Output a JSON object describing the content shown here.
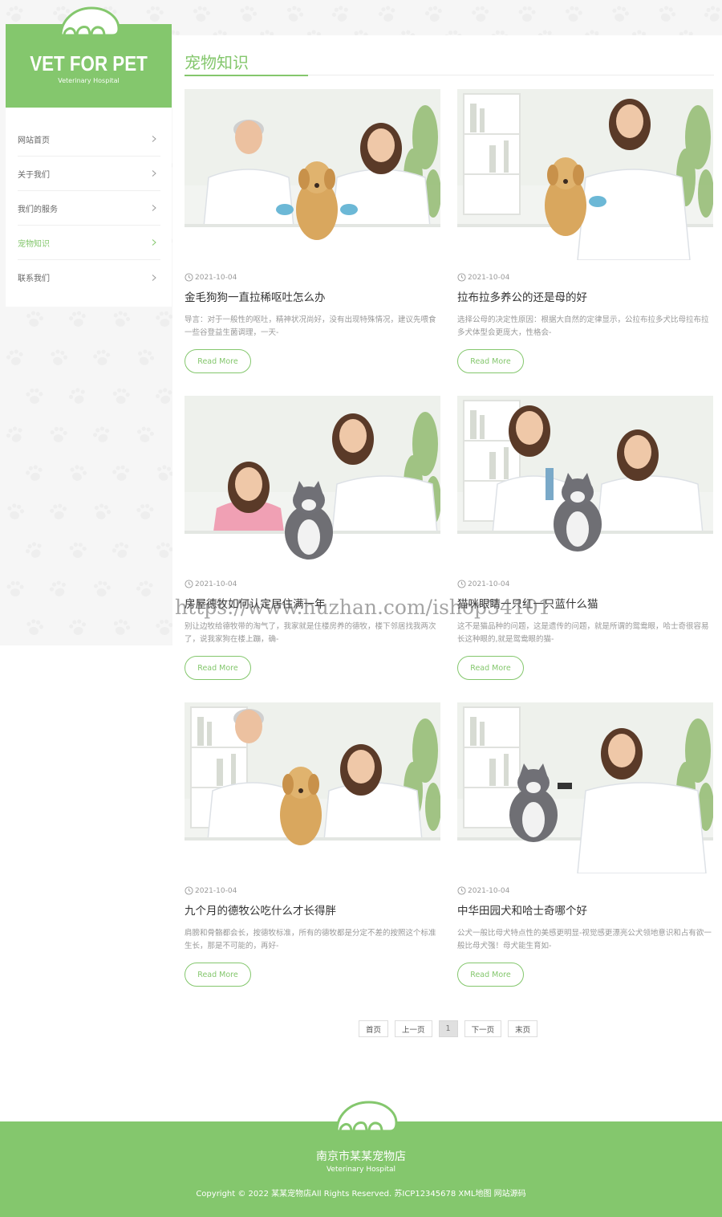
{
  "brand": {
    "name": "VET FOR PET",
    "subtitle": "Veterinary Hospital"
  },
  "nav": {
    "items": [
      {
        "label": "网站首页"
      },
      {
        "label": "关于我们"
      },
      {
        "label": "我们的服务"
      },
      {
        "label": "宠物知识"
      },
      {
        "label": "联系我们"
      }
    ],
    "active": "宠物知识"
  },
  "page": {
    "title": "宠物知识"
  },
  "articles": [
    {
      "date": "2021-10-04",
      "title": "金毛狗狗一直拉稀呕吐怎么办",
      "desc": "导言：对于一般性的呕吐，精神状况尚好，没有出现特殊情况，建议先喂食一些谷登益生菌调理，一天-",
      "image": "vet-man-woman-with-golden-puppy",
      "button": "Read More"
    },
    {
      "date": "2021-10-04",
      "title": "拉布拉多养公的还是母的好",
      "desc": "选择公母的决定性原因：根据大自然的定律显示，公拉布拉多犬比母拉布拉多犬体型会更庞大，性格会-",
      "image": "vet-woman-stethoscope-puppy",
      "button": "Read More"
    },
    {
      "date": "2021-10-04",
      "title": "房屋德牧如何认定居住满一年",
      "desc": "别让边牧给德牧带的淘气了，我家就是住楼房养的德牧，楼下邻居找我两次了，说我家狗在楼上蹦，确-",
      "image": "girl-vet-woman-with-cat",
      "button": "Read More"
    },
    {
      "date": "2021-10-04",
      "title": "猫咪眼睛一只红一只蓝什么猫",
      "desc": "这不是猫品种的问题，这是遗传的问题，就是所谓的鸳鸯眼，哈士奇很容易长这种眼的,就是鸳鸯眼的猫-",
      "image": "two-vets-grooming-cat",
      "button": "Read More"
    },
    {
      "date": "2021-10-04",
      "title": "九个月的德牧公吃什么才长得胖",
      "desc": "肩膀和骨骼都会长，按德牧标准，所有的德牧都是分定不差的按照这个标准生长，那是不可能的，再好-",
      "image": "vets-examining-golden-dog",
      "button": "Read More"
    },
    {
      "date": "2021-10-04",
      "title": "中华田园犬和哈士奇哪个好",
      "desc": "公犬一般比母犬特点性的美感更明显-视觉感更漂亮公犬领地意识和占有欲一般比母犬强！母犬能生育如-",
      "image": "vet-woman-otoscope-cat",
      "button": "Read More"
    }
  ],
  "watermark": "https://www.huzhan.com/ishop34101",
  "pagination": {
    "first": "首页",
    "prev": "上一页",
    "current": "1",
    "next": "下一页",
    "last": "末页"
  },
  "footer": {
    "name": "南京市某某宠物店",
    "subtitle": "Veterinary Hospital",
    "copyright": "Copyright © 2022 某某宠物店All Rights Reserved. 苏ICP12345678 XML地图 网站源码"
  },
  "colors": {
    "accent": "#84c76d",
    "background": "#f6f6f6"
  }
}
